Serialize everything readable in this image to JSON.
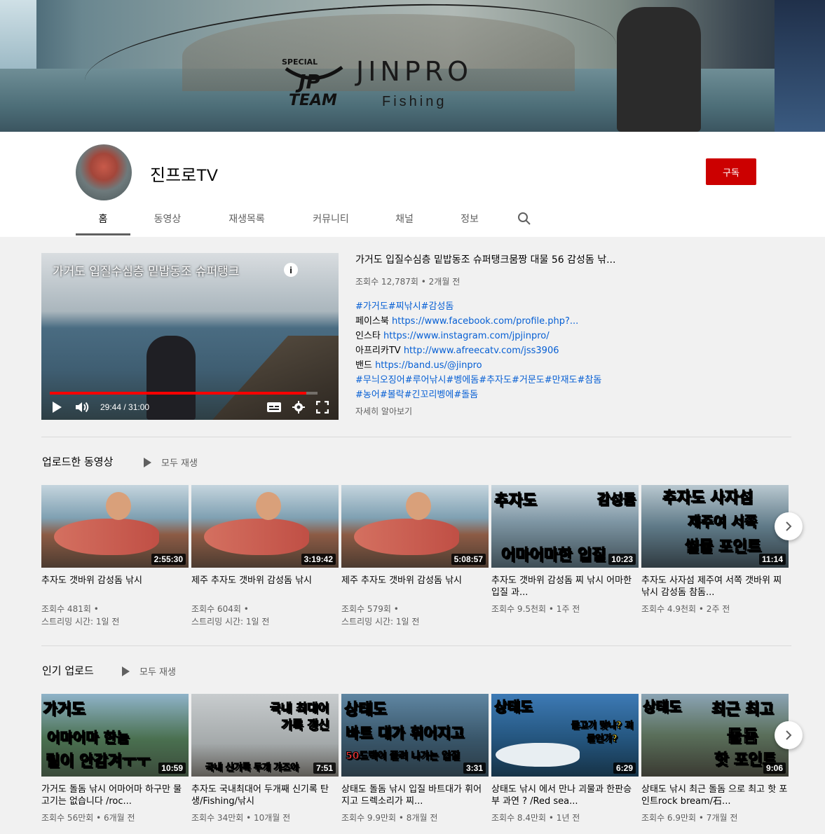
{
  "banner": {
    "logo_text": "JINPRO",
    "logo_sub": "Fishing",
    "logo_badge": "SPECIAL JP TEAM"
  },
  "channel": {
    "name": "진프로TV",
    "subscribe_label": "구독"
  },
  "tabs": [
    {
      "label": "홈",
      "active": true
    },
    {
      "label": "동영상"
    },
    {
      "label": "재생목록"
    },
    {
      "label": "커뮤니티"
    },
    {
      "label": "채널"
    },
    {
      "label": "정보"
    }
  ],
  "featured": {
    "overlay_title": "가거도 입질수심층 밑밥동조 슈퍼탱크",
    "time": "29:44 / 31:00",
    "progress": 0.959,
    "title": "가거도 입질수심층 밑밥동조 슈퍼탱크뭄짱 대물 56 감성돔 낚...",
    "meta": "조회수 12,787회 • 2개월 전",
    "description": [
      [
        {
          "t": "#가거도#찌낚시#감성돔",
          "link": true
        }
      ],
      [
        {
          "t": "페이스북 "
        },
        {
          "t": "https://www.facebook.com/profile.php?...",
          "link": true
        }
      ],
      [
        {
          "t": "인스타 "
        },
        {
          "t": "https://www.instagram.com/jpjinpro/",
          "link": true
        }
      ],
      [
        {
          "t": "아프리카TV "
        },
        {
          "t": "http://www.afreecatv.com/jss3906",
          "link": true
        }
      ],
      [
        {
          "t": "밴드 "
        },
        {
          "t": "https://band.us/@jinpro",
          "link": true
        }
      ],
      [
        {
          "t": "#무늬오징어#루어낚시#벵에돔#추자도#거문도#만재도#참돔",
          "link": true
        }
      ],
      [
        {
          "t": "#농어#볼락#긴꼬리벵에#돌돔",
          "link": true
        }
      ]
    ],
    "more": "자세히 알아보기"
  },
  "uploads": {
    "title": "업로드한 동영상",
    "play_all": "모두 재생",
    "videos": [
      {
        "title": "추자도 갯바위 감성돔 낚시",
        "duration": "2:55:30",
        "meta1": "조회수 481회 •",
        "meta2": "스트리밍 시간: 1일 전"
      },
      {
        "title": "제주 추자도 갯바위 감성돔 낚시",
        "duration": "3:19:42",
        "meta1": "조회수 604회 •",
        "meta2": "스트리밍 시간: 1일 전"
      },
      {
        "title": "제주 추자도 갯바위 감성돔 낚시",
        "duration": "5:08:57",
        "meta1": "조회수 579회 •",
        "meta2": "스트리밍 시간: 1일 전"
      },
      {
        "title": "추자도 갯바위 감성돔 찌 낚시 어마한 입질 과...",
        "duration": "10:23",
        "meta1": "조회수 9.5천회 • 1주 전",
        "meta2": "",
        "caps": [
          "추자도",
          "감성돔",
          "어마어마한 입질"
        ]
      },
      {
        "title": "추자도 사자섬 제주여 서쪽 갯바위 찌 낚시 감성돔 참돔...",
        "duration": "11:14",
        "meta1": "조회수 4.9천회 • 2주 전",
        "meta2": "",
        "caps": [
          "추자도 사자섬",
          "제주여 서쪽",
          "썰물 포인트"
        ]
      }
    ]
  },
  "popular": {
    "title": "인기 업로드",
    "play_all": "모두 재생",
    "videos": [
      {
        "title": "가거도 돌돔 낚시 어마어마 하구만 물고기는 없습니다 /roc...",
        "duration": "10:59",
        "meta1": "조회수 56만회 • 6개월 전",
        "caps": [
          "가거도",
          "어마어마 한놈",
          "릴이 안감겨ㅜㅜ"
        ]
      },
      {
        "title": "추자도 국내최대어 두개째 신기록 탄생/Fishing/낚시",
        "duration": "7:51",
        "meta1": "조회수 34만회 • 10개월 전",
        "caps": [
          "국내 최대어",
          "기록 갱신",
          "국내 신기록 두개 가즈아"
        ]
      },
      {
        "title": "상태도 돌돔 낚시 입질 바트대가 휘어지고 드렉소리가 찌...",
        "duration": "3:31",
        "meta1": "조회수 9.9만회 • 8개월 전",
        "caps": [
          "상태도",
          "바트 대가 휘어지고",
          "50드랙이 풀려 나가는 입질"
        ]
      },
      {
        "title": "상태도 낚시 에서 만나 괴물과 한판승부 과연 ? /Red sea...",
        "duration": "6:29",
        "meta1": "조회수 8.4만회 • 1년 전",
        "caps": [
          "상태도",
          "물고기 맞나? 괴물인가?"
        ]
      },
      {
        "title": "상태도 낚시 최근 돌돔 으로 최고 핫 포인트rock bream/石...",
        "duration": "9:06",
        "meta1": "조회수 6.9만회 • 7개월 전",
        "caps": [
          "상태도",
          "최근 최고",
          "돌돔",
          "핫 포인트"
        ]
      }
    ]
  }
}
